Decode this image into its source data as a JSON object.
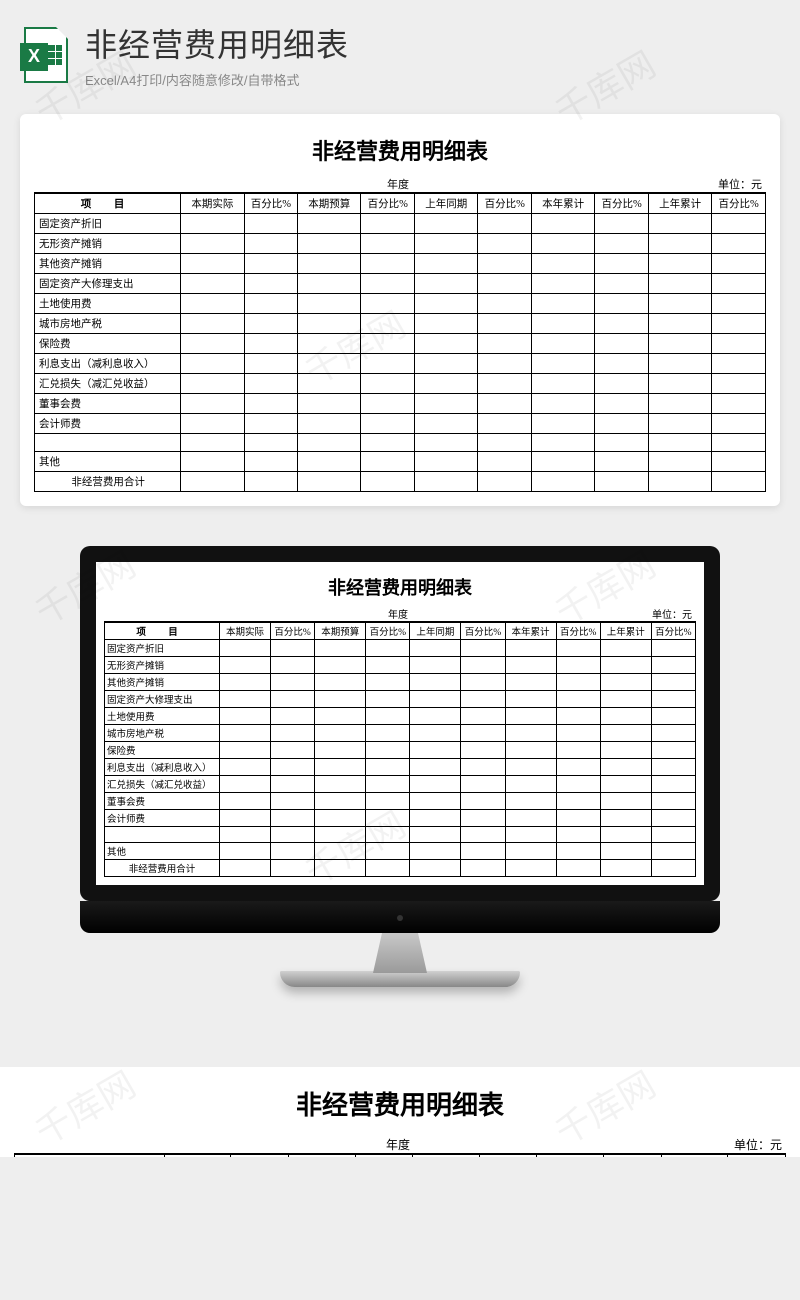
{
  "watermark": "千库网",
  "header": {
    "title": "非经营费用明细表",
    "subtitle": "Excel/A4打印/内容随意修改/自带格式",
    "icon_letter": "X"
  },
  "sheet": {
    "title": "非经营费用明细表",
    "year_label": "年度",
    "unit_label": "单位：元",
    "item_header": "项 目",
    "columns": [
      {
        "label": "本期实际"
      },
      {
        "label": "百分比%"
      },
      {
        "label": "本期预算"
      },
      {
        "label": "百分比%"
      },
      {
        "label": "上年同期"
      },
      {
        "label": "百分比%"
      },
      {
        "label": "本年累计"
      },
      {
        "label": "百分比%"
      },
      {
        "label": "上年累计"
      },
      {
        "label": "百分比%"
      }
    ],
    "rows": [
      "固定资产折旧",
      "无形资产摊销",
      "其他资产摊销",
      "固定资产大修理支出",
      "土地使用费",
      "城市房地产税",
      "保险费",
      "利息支出（减利息收入）",
      "汇兑损失（减汇兑收益）",
      "董事会费",
      "会计师费",
      "",
      "其他"
    ],
    "total_label": "非经营费用合计"
  }
}
